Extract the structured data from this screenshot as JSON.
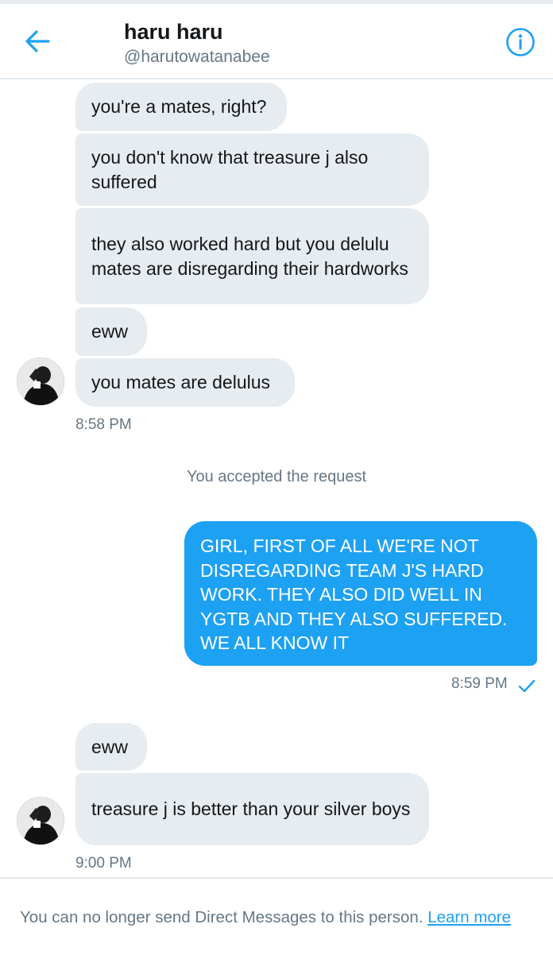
{
  "header": {
    "name": "haru haru",
    "handle": "@harutowatanabee",
    "back_icon": "arrow-left-icon",
    "info_icon": "info-icon",
    "accent": "#1da1f2"
  },
  "conversation": {
    "group1": [
      "you're a mates, right?",
      "you don't know that treasure j also suffered",
      "they also worked hard but you delulu mates are disregarding their hardworks",
      "eww",
      "you mates are delulus"
    ],
    "group1_time": "8:58 PM",
    "system_message": "You accepted the request",
    "sent_message": "GIRL, FIRST OF ALL WE'RE NOT DISREGARDING TEAM J'S HARD WORK. THEY ALSO DID WELL IN YGTB AND THEY ALSO SUFFERED. WE ALL KNOW IT",
    "sent_time": "8:59 PM",
    "sent_status_icon": "checkmark-icon",
    "group2": [
      "eww",
      "treasure j is better than your silver boys"
    ],
    "group2_time": "9:00 PM"
  },
  "footer": {
    "notice": "You can no longer send Direct Messages to this person.",
    "link": "Learn more"
  },
  "colors": {
    "incoming_bubble": "#e6ecf0",
    "outgoing_bubble": "#1da1f2",
    "secondary_text": "#657786"
  }
}
